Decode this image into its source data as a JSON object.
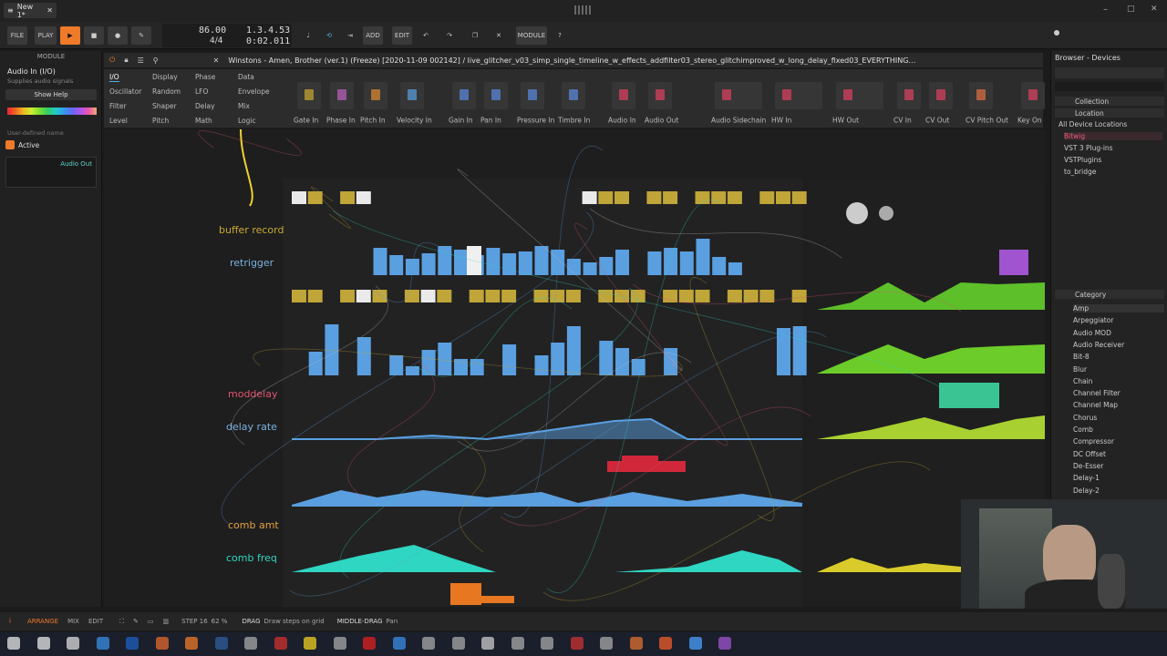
{
  "window": {
    "tab_title": "New 1*"
  },
  "transport": {
    "file": "FILE",
    "play_label": "PLAY",
    "tempo": "86.00",
    "timesig": "4/4",
    "position": "1.3.4.53",
    "time": "0:02.011",
    "add": "ADD",
    "edit": "EDIT",
    "module": "MODULE"
  },
  "module_panel": {
    "header": "MODULE",
    "name": "Audio In (I/O)",
    "desc": "Supplies audio signals",
    "help": "Show Help",
    "user_name": "User-defined name",
    "active": "Active",
    "audio_out": "Audio Out"
  },
  "editor": {
    "title": "Winstons - Amen, Brother (ver.1) (Freeze) [2020-11-09 002142] / live_glitcher_v03_simp_single_timeline_w_effects_addfilter03_stereo_glitchimproved_w_long_delay_fixed03_EVERYTHINGWORKING_w_fx",
    "categories": [
      "I/O",
      "Display",
      "Phase",
      "Data",
      "Oscillator",
      "Random",
      "LFO",
      "Envelope",
      "Filter",
      "Shaper",
      "Delay",
      "Mix",
      "Level",
      "Pitch",
      "Math",
      "Logic"
    ],
    "modules": [
      "Gate In",
      "Phase In",
      "Pitch In",
      "Velocity In",
      "Gain In",
      "Pan In",
      "Pressure In",
      "Timbre In",
      "Audio In",
      "Audio Out",
      "Audio Sidechain",
      "HW In",
      "HW Out",
      "CV In",
      "CV Out",
      "CV Pitch Out",
      "Key On"
    ],
    "rows": [
      {
        "label": "buffer record",
        "color": "#c9a832"
      },
      {
        "label": "retrigger",
        "color": "#7ab2e0"
      },
      {
        "label": "moddelay",
        "color": "#e0546e"
      },
      {
        "label": "delay rate",
        "color": "#7ab2e0"
      },
      {
        "label": "comb amt",
        "color": "#e5a040"
      },
      {
        "label": "comb freq",
        "color": "#2fd6c2"
      }
    ]
  },
  "browser": {
    "title": "Browser - Devices",
    "location": "Location",
    "collection": "Collection",
    "locations": [
      "All Device Locations",
      "Bitwig",
      "VST 3 Plug-ins",
      "VSTPlugins",
      "to_bridge"
    ],
    "category": "Category",
    "categories": [
      "Amp",
      "Arpeggiator",
      "Audio MOD",
      "Audio Receiver",
      "Bit-8",
      "Blur",
      "Chain",
      "Channel Filter",
      "Channel Map",
      "Chorus",
      "Comb",
      "Compressor",
      "DC Offset",
      "De-Esser",
      "Delay-1",
      "Delay-2"
    ]
  },
  "status": {
    "arrange": "ARRANGE",
    "mix": "MIX",
    "edit": "EDIT",
    "step": "STEP 16",
    "pct": "62 %",
    "drag": "DRAG",
    "drag_desc": "Draw steps on grid",
    "middle": "MIDDLE-DRAG",
    "middle_desc": "Pan"
  }
}
